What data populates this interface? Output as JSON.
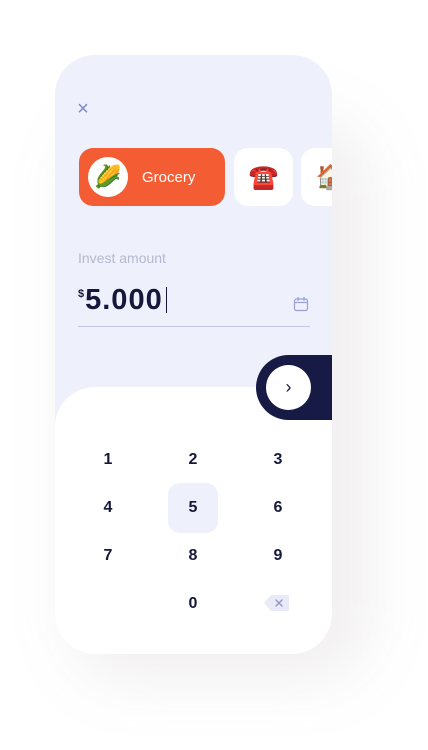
{
  "header": {
    "close_icon": "×"
  },
  "categories": [
    {
      "label": "Grocery",
      "emoji": "🌽",
      "active": true
    },
    {
      "label": "",
      "emoji": "☎️",
      "active": false
    },
    {
      "label": "",
      "emoji": "🏠",
      "active": false
    }
  ],
  "invest": {
    "label": "Invest amount",
    "currency": "$",
    "value": "5.000"
  },
  "next_button": {
    "icon": "›"
  },
  "keypad": {
    "keys": [
      "1",
      "2",
      "3",
      "4",
      "5",
      "6",
      "7",
      "8",
      "9",
      "0"
    ],
    "selected": "5",
    "backspace_icon": "backspace-icon"
  },
  "colors": {
    "accent": "#f45d34",
    "dark": "#161a44",
    "background": "#eef0fc"
  }
}
